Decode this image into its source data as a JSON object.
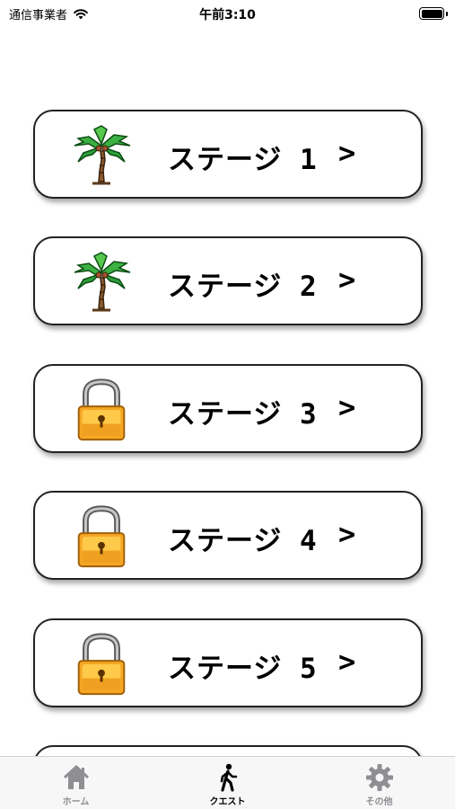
{
  "status_bar": {
    "carrier": "通信事業者",
    "time": "午前3:10",
    "wifi_icon": "wifi-icon",
    "battery_icon": "battery-icon"
  },
  "stages": [
    {
      "label": "ステージ 1",
      "arrow": ">",
      "icon": "palm-tree-icon",
      "unlocked": true
    },
    {
      "label": "ステージ 2",
      "arrow": ">",
      "icon": "palm-tree-icon",
      "unlocked": true
    },
    {
      "label": "ステージ 3",
      "arrow": ">",
      "icon": "padlock-icon",
      "unlocked": false
    },
    {
      "label": "ステージ 4",
      "arrow": ">",
      "icon": "padlock-icon",
      "unlocked": false
    },
    {
      "label": "ステージ 5",
      "arrow": ">",
      "icon": "padlock-icon",
      "unlocked": false
    }
  ],
  "tab_bar": {
    "tabs": [
      {
        "label": "ホーム",
        "icon": "home-icon",
        "active": false
      },
      {
        "label": "クエスト",
        "icon": "walking-person-icon",
        "active": true
      },
      {
        "label": "その他",
        "icon": "gear-icon",
        "active": false
      }
    ]
  },
  "colors": {
    "active_tab": "#000000",
    "inactive_tab": "#8e8e93",
    "lock_body": "#f5a623",
    "palm_leaves": "#2ea043"
  }
}
